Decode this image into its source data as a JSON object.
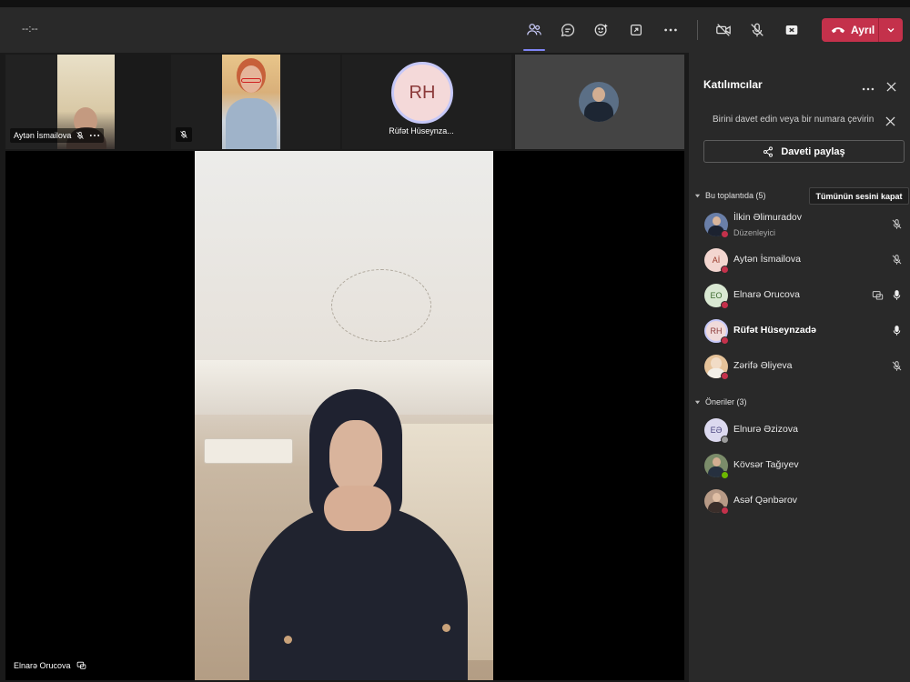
{
  "toolbar": {
    "timer": "--:--",
    "leave_label": "Ayrıl",
    "icons": [
      "people-icon",
      "chat-icon",
      "reactions-icon",
      "share-screen-icon",
      "more-icon",
      "camera-off-icon",
      "mic-off-icon",
      "share-tray-icon",
      "phone-hangup-icon",
      "chevron-down-icon"
    ]
  },
  "stage": {
    "thumbnails": [
      {
        "name": "Aytən İsmailova",
        "muted": true
      },
      {
        "name": "",
        "muted": true
      },
      {
        "name": "Rüfət Hüseynza...",
        "initials": "RH"
      },
      {
        "name": ""
      }
    ],
    "main_speaker": "Elnarə Orucova"
  },
  "panel": {
    "title": "Katılımcılar",
    "invite_hint": "Birini davet edin veya bir numara çevirin",
    "share_invite": "Daveti paylaş",
    "in_meeting": {
      "heading": "Bu toplantıda (5)",
      "mute_all": "Tümünün sesini kapat",
      "people": [
        {
          "name": "İlkin Əlimuradov",
          "role": "Düzenleyici",
          "mic": "muted",
          "avatar_color": "#6a7fa8"
        },
        {
          "name": "Aytən İsmailova",
          "initials": "Aİ",
          "mic": "muted",
          "avatar_color": "#f3d6d0"
        },
        {
          "name": "Elnarə Orucova",
          "initials": "EO",
          "mic": "on",
          "sharing": true,
          "avatar_color": "#d9e8d2"
        },
        {
          "name": "Rüfət Hüseynzadə",
          "initials": "RH",
          "mic": "on",
          "speaking": true,
          "avatar_color": "#f0dada"
        },
        {
          "name": "Zərifə Əliyeva",
          "mic": "muted",
          "avatar_color": "#e6c39a"
        }
      ]
    },
    "suggestions": {
      "heading": "Öneriler (3)",
      "people": [
        {
          "name": "Elnurə Əzizova",
          "initials": "EƏ",
          "avatar_color": "#dcd9ef"
        },
        {
          "name": "Kövsər Tağıyev",
          "avatar_color": "#7b8c6a"
        },
        {
          "name": "Asəf Qənbərov",
          "avatar_color": "#b79a86"
        }
      ]
    }
  },
  "colors": {
    "accent": "#7f85f5",
    "leave": "#c4314b",
    "status_busy": "#c4314b",
    "status_available": "#6bb700"
  }
}
